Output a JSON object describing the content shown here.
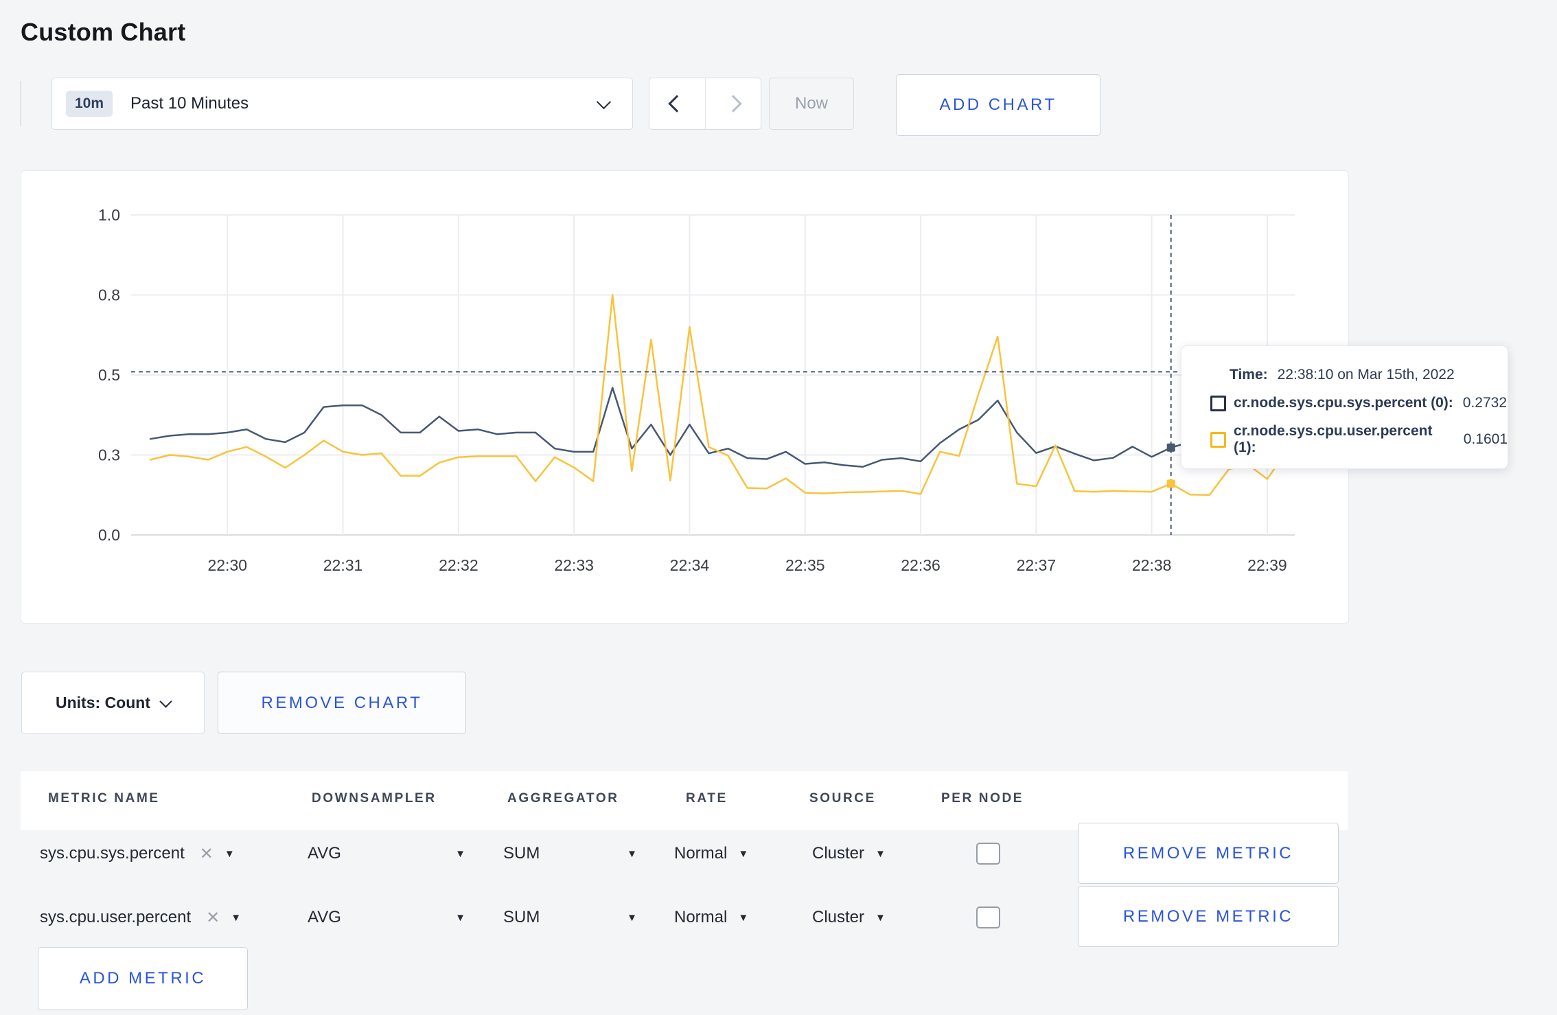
{
  "page": {
    "title": "Custom Chart",
    "bg": "#f4f5f7",
    "accent_blue": "#2b55db"
  },
  "toolbar": {
    "range_badge": "10m",
    "range_label": "Past 10 Minutes",
    "now_label": "Now",
    "add_chart_label": "ADD CHART"
  },
  "chart_data": {
    "type": "line",
    "title": "",
    "xlabel": "",
    "ylabel": "",
    "ylim": [
      0,
      1
    ],
    "grid": true,
    "legend_position": "tooltip-only",
    "x_domain": [
      "22:29:10",
      "22:39:10"
    ],
    "x_start": "22:29:20",
    "interval_seconds": 10,
    "x_ticks": [
      "22:30",
      "22:31",
      "22:32",
      "22:33",
      "22:34",
      "22:35",
      "22:36",
      "22:37",
      "22:38",
      "22:39"
    ],
    "y_ticks": {
      "values": [
        0,
        0.25,
        0.5,
        0.75,
        1.0
      ],
      "labels": [
        "0.0",
        "0.3",
        "0.5",
        "0.8",
        "1.0"
      ]
    },
    "series": [
      {
        "name": "cr.node.sys.cpu.sys.percent",
        "color": "#475872",
        "values": [
          0.3,
          0.31,
          0.315,
          0.315,
          0.32,
          0.33,
          0.3,
          0.29,
          0.32,
          0.4,
          0.405,
          0.405,
          0.375,
          0.32,
          0.32,
          0.37,
          0.325,
          0.33,
          0.315,
          0.32,
          0.32,
          0.27,
          0.26,
          0.26,
          0.46,
          0.27,
          0.345,
          0.25,
          0.345,
          0.255,
          0.27,
          0.24,
          0.237,
          0.26,
          0.222,
          0.227,
          0.218,
          0.213,
          0.235,
          0.24,
          0.23,
          0.287,
          0.33,
          0.36,
          0.42,
          0.32,
          0.256,
          0.277,
          0.254,
          0.233,
          0.241,
          0.276,
          0.244,
          0.2732,
          0.29,
          0.3,
          0.29,
          0.285,
          0.3,
          0.28
        ]
      },
      {
        "name": "cr.node.sys.cpu.user.percent",
        "color": "#f9c33c",
        "values": [
          0.235,
          0.25,
          0.245,
          0.235,
          0.26,
          0.275,
          0.245,
          0.21,
          0.25,
          0.295,
          0.26,
          0.25,
          0.255,
          0.185,
          0.185,
          0.226,
          0.243,
          0.246,
          0.246,
          0.246,
          0.168,
          0.243,
          0.211,
          0.168,
          0.75,
          0.2,
          0.61,
          0.17,
          0.65,
          0.275,
          0.248,
          0.147,
          0.145,
          0.177,
          0.132,
          0.13,
          0.133,
          0.134,
          0.136,
          0.138,
          0.128,
          0.26,
          0.247,
          0.44,
          0.62,
          0.16,
          0.152,
          0.28,
          0.137,
          0.135,
          0.138,
          0.136,
          0.135,
          0.1601,
          0.126,
          0.125,
          0.205,
          0.22,
          0.175,
          0.26
        ]
      }
    ],
    "crosshair": {
      "time": "22:38:10",
      "y_value": 0.51,
      "points": [
        {
          "series": 0,
          "value": 0.2732
        },
        {
          "series": 1,
          "value": 0.1601
        }
      ]
    }
  },
  "tooltip": {
    "time_label": "Time:",
    "time_value": "22:38:10 on Mar 15th, 2022",
    "rows": [
      {
        "name": "cr.node.sys.cpu.sys.percent (0):",
        "value": "0.2732",
        "color": "#24304d"
      },
      {
        "name": "cr.node.sys.cpu.user.percent (1):",
        "value": "0.1601",
        "color": "#f5b916"
      }
    ]
  },
  "chart_controls": {
    "units_label": "Units: Count",
    "remove_chart_label": "REMOVE CHART"
  },
  "metrics_table": {
    "headers": [
      "METRIC NAME",
      "DOWNSAMPLER",
      "AGGREGATOR",
      "RATE",
      "SOURCE",
      "PER NODE"
    ],
    "rows": [
      {
        "name": "sys.cpu.sys.percent",
        "downsampler": "AVG",
        "aggregator": "SUM",
        "rate": "Normal",
        "source": "Cluster",
        "per_node_checked": false,
        "remove_label": "REMOVE METRIC"
      },
      {
        "name": "sys.cpu.user.percent",
        "downsampler": "AVG",
        "aggregator": "SUM",
        "rate": "Normal",
        "source": "Cluster",
        "per_node_checked": false,
        "remove_label": "REMOVE METRIC"
      }
    ],
    "add_metric_label": "ADD METRIC"
  }
}
